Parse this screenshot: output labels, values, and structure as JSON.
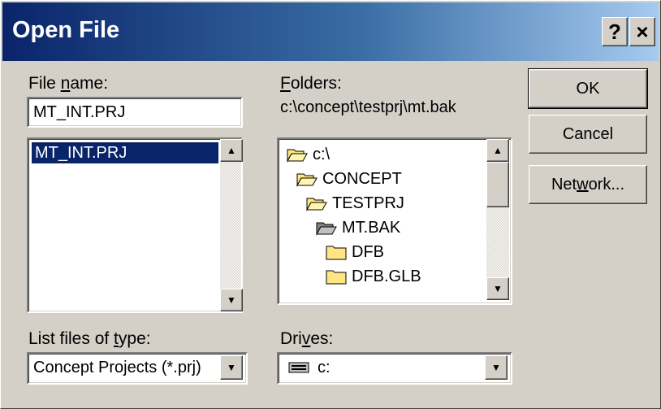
{
  "window": {
    "title": "Open File",
    "help_label": "?",
    "close_label": "×"
  },
  "file_name": {
    "label": "File name:",
    "mnemonic": "n",
    "value": "MT_INT.PRJ",
    "list_items": [
      "MT_INT.PRJ"
    ]
  },
  "folders": {
    "label": "Folders:",
    "mnemonic": "F",
    "path": "c:\\concept\\testprj\\mt.bak",
    "tree": [
      {
        "label": "c:\\",
        "state": "open"
      },
      {
        "label": "CONCEPT",
        "state": "open"
      },
      {
        "label": "TESTPRJ",
        "state": "open"
      },
      {
        "label": "MT.BAK",
        "state": "current"
      },
      {
        "label": "DFB",
        "state": "closed"
      },
      {
        "label": "DFB.GLB",
        "state": "closed"
      }
    ]
  },
  "file_type": {
    "label": "List files of type:",
    "mnemonic": "t",
    "value": "Concept Projects (*.prj)"
  },
  "drives": {
    "label": "Drives:",
    "mnemonic": "v",
    "value": "c:"
  },
  "buttons": {
    "ok": "OK",
    "cancel": "Cancel",
    "network": "Network..."
  }
}
